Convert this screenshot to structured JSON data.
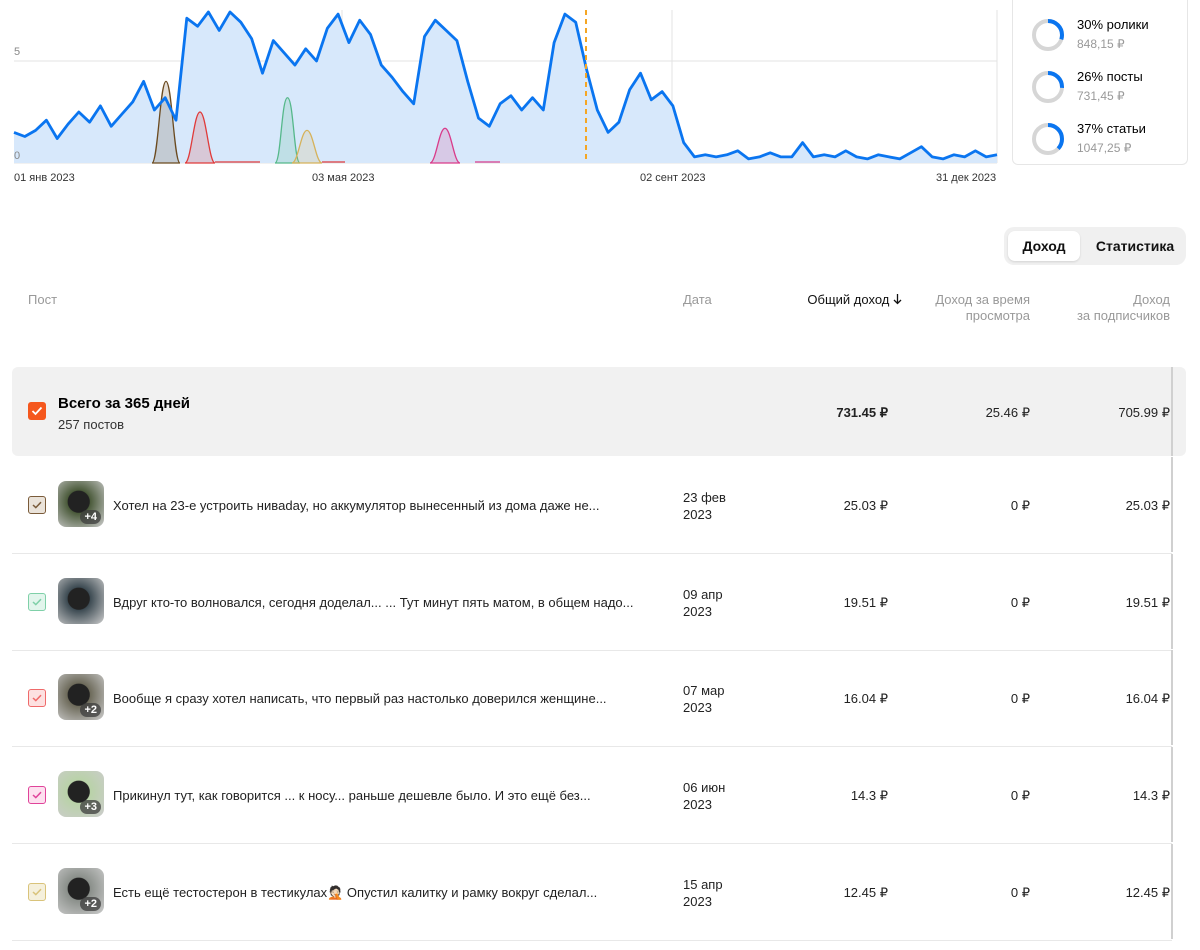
{
  "chart": {
    "x_ticks": [
      "01 янв 2023",
      "03 мая 2023",
      "02 сент 2023",
      "31 дек 2023"
    ],
    "y_ticks": [
      "5",
      "0"
    ]
  },
  "chart_data": {
    "type": "area",
    "title": "",
    "xlabel": "",
    "ylabel": "",
    "ylim": [
      0,
      7.5
    ],
    "x": [
      "01 янв 2023",
      "03 мая 2023",
      "02 сент 2023",
      "31 дек 2023"
    ],
    "series": [
      {
        "name": "total",
        "color": "#0a75f0",
        "values": [
          1.5,
          1.3,
          1.6,
          2.1,
          1.2,
          1.9,
          2.5,
          2.0,
          2.8,
          1.8,
          2.4,
          3.0,
          4.0,
          2.6,
          3.2,
          2.1,
          7.1,
          6.7,
          7.4,
          6.5,
          7.4,
          6.9,
          6.1,
          4.4,
          6.0,
          5.4,
          4.8,
          5.6,
          5.0,
          6.6,
          7.3,
          5.9,
          7.0,
          6.3,
          4.8,
          4.2,
          3.5,
          2.9,
          6.2,
          7.0,
          6.5,
          6.0,
          4.0,
          2.2,
          1.8,
          2.9,
          3.3,
          2.6,
          3.2,
          2.6,
          5.9,
          7.3,
          6.9,
          4.6,
          2.6,
          1.5,
          2.0,
          3.6,
          4.4,
          3.1,
          3.5,
          2.8,
          1.0,
          0.3,
          0.4,
          0.3,
          0.4,
          0.6,
          0.2,
          0.3,
          0.5,
          0.3,
          0.3,
          1.0,
          0.3,
          0.4,
          0.3,
          0.6,
          0.3,
          0.2,
          0.4,
          0.3,
          0.2,
          0.5,
          0.8,
          0.3,
          0.2,
          0.4,
          0.3,
          0.6,
          0.3,
          0.4
        ]
      },
      {
        "name": "",
        "color": "#6b4a1f",
        "values": []
      },
      {
        "name": "",
        "color": "#e03a3a",
        "values": []
      },
      {
        "name": "",
        "color": "#55b88a",
        "values": []
      },
      {
        "name": "",
        "color": "#d6b25a",
        "values": []
      },
      {
        "name": "",
        "color": "#d93b8a",
        "values": []
      }
    ],
    "marker_line_color": "#f5a623",
    "grid": true
  },
  "summary": {
    "items": [
      {
        "pct": "30%",
        "label": "ролики",
        "value": "848,15 ₽",
        "fraction": 0.3
      },
      {
        "pct": "26%",
        "label": "посты",
        "value": "731,45 ₽",
        "fraction": 0.26
      },
      {
        "pct": "37%",
        "label": "статьи",
        "value": "1047,25 ₽",
        "fraction": 0.37
      }
    ],
    "ring_color": "#0a75f0",
    "track_color": "#d6d6d6"
  },
  "tabs": {
    "income": "Доход",
    "stats": "Статистика"
  },
  "table": {
    "col_post": "Пост",
    "col_date": "Дата",
    "col_total": "Общий доход",
    "col_view_1": "Доход за время",
    "col_view_2": "просмотра",
    "col_subs_1": "Доход",
    "col_subs_2": "за подписчиков"
  },
  "total_row": {
    "title": "Всего за 365 дней",
    "subtitle": "257 постов",
    "total": "731.45 ₽",
    "view": "25.46 ₽",
    "subs": "705.99 ₽",
    "checkbox_color": "#f5571d"
  },
  "rows": [
    {
      "title": "Хотел на 23-е устроить нивaday, но аккумулятор вынесенный из дома даже не...",
      "date1": "23 фев",
      "date2": "2023",
      "total": "25.03 ₽",
      "view": "0 ₽",
      "subs": "25.03 ₽",
      "badge": "+4",
      "cb_bg": "#eae3da",
      "cb_color": "#7a5b3a",
      "thumb": "#4a5a3a"
    },
    {
      "title": "Вдруг кто-то волновался, сегодня доделал... ... Тут минут пять матом, в общем надо...",
      "date1": "09 апр",
      "date2": "2023",
      "total": "19.51 ₽",
      "view": "0 ₽",
      "subs": "19.51 ₽",
      "badge": "",
      "cb_bg": "#e2f5ec",
      "cb_color": "#7fd0a8",
      "thumb": "#3c4a52"
    },
    {
      "title": "Вообще я сразу хотел написать, что первый раз настолько доверился женщине...",
      "date1": "07 мар",
      "date2": "2023",
      "total": "16.04 ₽",
      "view": "0 ₽",
      "subs": "16.04 ₽",
      "badge": "+2",
      "cb_bg": "#fde1e1",
      "cb_color": "#ef6a6a",
      "thumb": "#6d6a5a"
    },
    {
      "title": "Прикинул тут, как говорится ... к носу... раньше дешевле было. И это ещё без...",
      "date1": "06 июн",
      "date2": "2023",
      "total": "14.3 ₽",
      "view": "0 ₽",
      "subs": "14.3 ₽",
      "badge": "+3",
      "cb_bg": "#fde0ef",
      "cb_color": "#e0439a",
      "thumb": "#b9d2a8"
    },
    {
      "title": "Есть ещё тестостерон в тестикулах🤦🏻 Опустил калитку и рамку вокруг сделал...",
      "date1": "15 апр",
      "date2": "2023",
      "total": "12.45 ₽",
      "view": "0 ₽",
      "subs": "12.45 ₽",
      "badge": "+2",
      "cb_bg": "#f5f0dc",
      "cb_color": "#d9c37a",
      "thumb": "#8a8f8a"
    }
  ]
}
